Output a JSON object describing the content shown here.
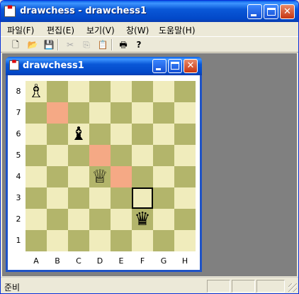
{
  "app": {
    "title": "drawchess - drawchess1"
  },
  "window_controls": {
    "close": "✕"
  },
  "menu": [
    {
      "label": "파일(F)"
    },
    {
      "label": "편집(E)"
    },
    {
      "label": "보기(V)"
    },
    {
      "label": "창(W)"
    },
    {
      "label": "도움말(H)"
    }
  ],
  "toolbar": [
    {
      "icon": "new-document-icon",
      "glyph": "🗋",
      "enabled": true
    },
    {
      "icon": "open-folder-icon",
      "glyph": "📂",
      "enabled": true
    },
    {
      "icon": "save-icon",
      "glyph": "💾",
      "enabled": true
    },
    {
      "icon": "cut-icon",
      "glyph": "✂",
      "enabled": false
    },
    {
      "icon": "copy-icon",
      "glyph": "⎘",
      "enabled": false
    },
    {
      "icon": "paste-icon",
      "glyph": "📋",
      "enabled": false
    },
    {
      "icon": "print-icon",
      "glyph": "🖶",
      "enabled": true
    },
    {
      "icon": "help-icon",
      "glyph": "?",
      "enabled": true
    }
  ],
  "child_window": {
    "title": "drawchess1"
  },
  "board": {
    "files": [
      "A",
      "B",
      "C",
      "D",
      "E",
      "F",
      "G",
      "H"
    ],
    "ranks": [
      "8",
      "7",
      "6",
      "5",
      "4",
      "3",
      "2",
      "1"
    ],
    "colors": {
      "light": "#f0ecbc",
      "dark": "#b3b56b",
      "highlight": "#f5a985"
    },
    "highlighted_squares": [
      "B7",
      "D5",
      "E4"
    ],
    "selected_square": "F3",
    "pieces": [
      {
        "square": "A8",
        "type": "bishop",
        "color": "white",
        "glyph": "♗"
      },
      {
        "square": "C6",
        "type": "bishop",
        "color": "black",
        "glyph": "♝"
      },
      {
        "square": "D4",
        "type": "queen",
        "color": "white",
        "glyph": "♕"
      },
      {
        "square": "F2",
        "type": "queen",
        "color": "black",
        "glyph": "♛"
      }
    ]
  },
  "statusbar": {
    "text": "준비"
  }
}
